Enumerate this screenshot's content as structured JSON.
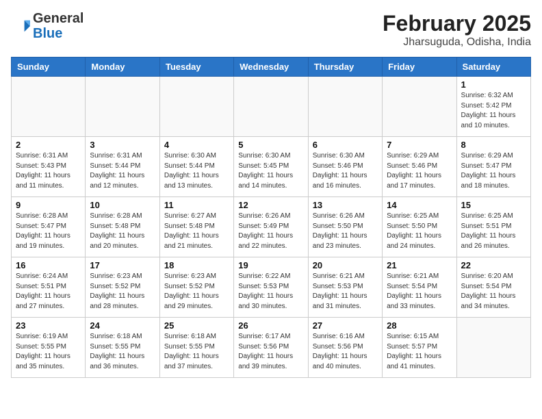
{
  "header": {
    "logo_general": "General",
    "logo_blue": "Blue",
    "month_year": "February 2025",
    "location": "Jharsuguda, Odisha, India"
  },
  "weekdays": [
    "Sunday",
    "Monday",
    "Tuesday",
    "Wednesday",
    "Thursday",
    "Friday",
    "Saturday"
  ],
  "weeks": [
    [
      {
        "day": "",
        "info": ""
      },
      {
        "day": "",
        "info": ""
      },
      {
        "day": "",
        "info": ""
      },
      {
        "day": "",
        "info": ""
      },
      {
        "day": "",
        "info": ""
      },
      {
        "day": "",
        "info": ""
      },
      {
        "day": "1",
        "info": "Sunrise: 6:32 AM\nSunset: 5:42 PM\nDaylight: 11 hours\nand 10 minutes."
      }
    ],
    [
      {
        "day": "2",
        "info": "Sunrise: 6:31 AM\nSunset: 5:43 PM\nDaylight: 11 hours\nand 11 minutes."
      },
      {
        "day": "3",
        "info": "Sunrise: 6:31 AM\nSunset: 5:44 PM\nDaylight: 11 hours\nand 12 minutes."
      },
      {
        "day": "4",
        "info": "Sunrise: 6:30 AM\nSunset: 5:44 PM\nDaylight: 11 hours\nand 13 minutes."
      },
      {
        "day": "5",
        "info": "Sunrise: 6:30 AM\nSunset: 5:45 PM\nDaylight: 11 hours\nand 14 minutes."
      },
      {
        "day": "6",
        "info": "Sunrise: 6:30 AM\nSunset: 5:46 PM\nDaylight: 11 hours\nand 16 minutes."
      },
      {
        "day": "7",
        "info": "Sunrise: 6:29 AM\nSunset: 5:46 PM\nDaylight: 11 hours\nand 17 minutes."
      },
      {
        "day": "8",
        "info": "Sunrise: 6:29 AM\nSunset: 5:47 PM\nDaylight: 11 hours\nand 18 minutes."
      }
    ],
    [
      {
        "day": "9",
        "info": "Sunrise: 6:28 AM\nSunset: 5:47 PM\nDaylight: 11 hours\nand 19 minutes."
      },
      {
        "day": "10",
        "info": "Sunrise: 6:28 AM\nSunset: 5:48 PM\nDaylight: 11 hours\nand 20 minutes."
      },
      {
        "day": "11",
        "info": "Sunrise: 6:27 AM\nSunset: 5:48 PM\nDaylight: 11 hours\nand 21 minutes."
      },
      {
        "day": "12",
        "info": "Sunrise: 6:26 AM\nSunset: 5:49 PM\nDaylight: 11 hours\nand 22 minutes."
      },
      {
        "day": "13",
        "info": "Sunrise: 6:26 AM\nSunset: 5:50 PM\nDaylight: 11 hours\nand 23 minutes."
      },
      {
        "day": "14",
        "info": "Sunrise: 6:25 AM\nSunset: 5:50 PM\nDaylight: 11 hours\nand 24 minutes."
      },
      {
        "day": "15",
        "info": "Sunrise: 6:25 AM\nSunset: 5:51 PM\nDaylight: 11 hours\nand 26 minutes."
      }
    ],
    [
      {
        "day": "16",
        "info": "Sunrise: 6:24 AM\nSunset: 5:51 PM\nDaylight: 11 hours\nand 27 minutes."
      },
      {
        "day": "17",
        "info": "Sunrise: 6:23 AM\nSunset: 5:52 PM\nDaylight: 11 hours\nand 28 minutes."
      },
      {
        "day": "18",
        "info": "Sunrise: 6:23 AM\nSunset: 5:52 PM\nDaylight: 11 hours\nand 29 minutes."
      },
      {
        "day": "19",
        "info": "Sunrise: 6:22 AM\nSunset: 5:53 PM\nDaylight: 11 hours\nand 30 minutes."
      },
      {
        "day": "20",
        "info": "Sunrise: 6:21 AM\nSunset: 5:53 PM\nDaylight: 11 hours\nand 31 minutes."
      },
      {
        "day": "21",
        "info": "Sunrise: 6:21 AM\nSunset: 5:54 PM\nDaylight: 11 hours\nand 33 minutes."
      },
      {
        "day": "22",
        "info": "Sunrise: 6:20 AM\nSunset: 5:54 PM\nDaylight: 11 hours\nand 34 minutes."
      }
    ],
    [
      {
        "day": "23",
        "info": "Sunrise: 6:19 AM\nSunset: 5:55 PM\nDaylight: 11 hours\nand 35 minutes."
      },
      {
        "day": "24",
        "info": "Sunrise: 6:18 AM\nSunset: 5:55 PM\nDaylight: 11 hours\nand 36 minutes."
      },
      {
        "day": "25",
        "info": "Sunrise: 6:18 AM\nSunset: 5:55 PM\nDaylight: 11 hours\nand 37 minutes."
      },
      {
        "day": "26",
        "info": "Sunrise: 6:17 AM\nSunset: 5:56 PM\nDaylight: 11 hours\nand 39 minutes."
      },
      {
        "day": "27",
        "info": "Sunrise: 6:16 AM\nSunset: 5:56 PM\nDaylight: 11 hours\nand 40 minutes."
      },
      {
        "day": "28",
        "info": "Sunrise: 6:15 AM\nSunset: 5:57 PM\nDaylight: 11 hours\nand 41 minutes."
      },
      {
        "day": "",
        "info": ""
      }
    ]
  ]
}
